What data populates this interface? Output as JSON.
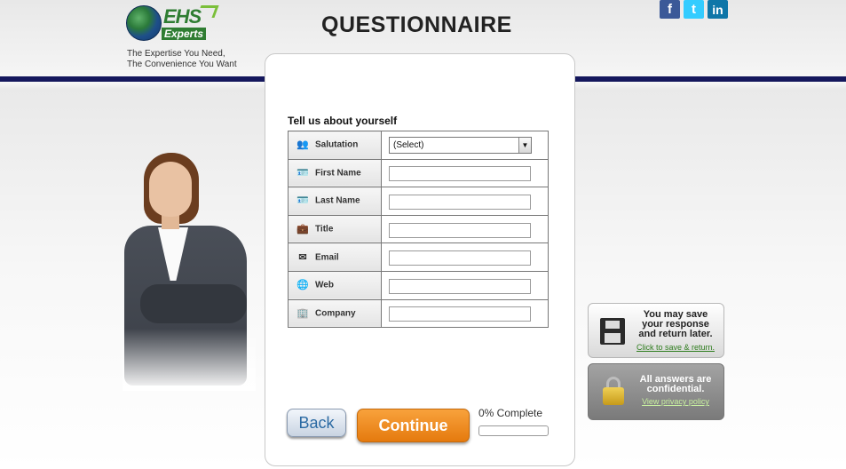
{
  "header": {
    "logo_brand": "EHS",
    "logo_sub": "Experts",
    "tagline_line1": "The Expertise You Need,",
    "tagline_line2": "The Convenience You Want",
    "title": "QUESTIONNAIRE"
  },
  "social": [
    {
      "icon": "facebook-icon",
      "label": "f"
    },
    {
      "icon": "twitter-icon",
      "label": "t"
    },
    {
      "icon": "linkedin-icon",
      "label": "in"
    }
  ],
  "form": {
    "section_title": "Tell us about yourself",
    "salutation": {
      "label": "Salutation",
      "icon": "people-icon",
      "value": "(Select)"
    },
    "fields": [
      {
        "label": "First Name",
        "icon": "id-card-icon",
        "value": ""
      },
      {
        "label": "Last Name",
        "icon": "id-card-icon",
        "value": ""
      },
      {
        "label": "Title",
        "icon": "briefcase-icon",
        "value": ""
      },
      {
        "label": "Email",
        "icon": "envelope-icon",
        "value": ""
      },
      {
        "label": "Web",
        "icon": "globe-icon",
        "value": ""
      },
      {
        "label": "Company",
        "icon": "building-icon",
        "value": ""
      }
    ]
  },
  "nav": {
    "back_label": "Back",
    "continue_label": "Continue",
    "progress_label": "0% Complete",
    "progress_fraction": 0
  },
  "save_panel": {
    "line1": "You may save",
    "line2": "your response",
    "line3": "and return later.",
    "link": "Click to save & return."
  },
  "confidential_panel": {
    "line1": "All answers are",
    "line2": "confidential.",
    "link": "View privacy policy"
  },
  "colors": {
    "navy_bar": "#14175c",
    "continue_orange": "#e57a0e",
    "link_green": "#2e7d1e"
  }
}
